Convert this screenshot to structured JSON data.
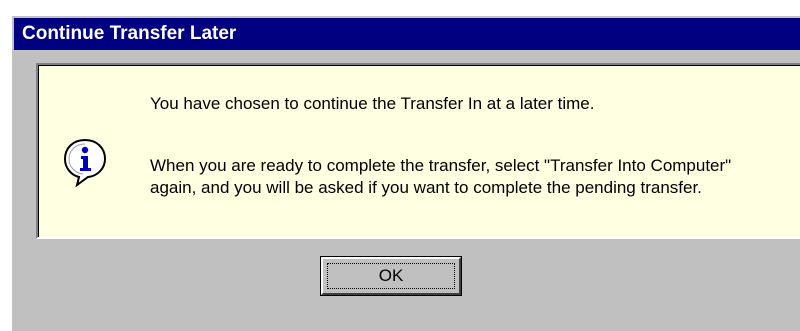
{
  "dialog": {
    "title": "Continue Transfer Later",
    "message_line_1": "You have chosen to continue the Transfer In at a later time.",
    "message_line_2": "When you are ready to complete the transfer, select \"Transfer Into Computer\" again, and you will be asked if you want to complete the pending transfer.",
    "icon": "info-icon",
    "ok_label": "OK"
  },
  "colors": {
    "title_bar": "#000080",
    "window_face": "#c0c0c0",
    "message_background": "#ffffe1"
  }
}
